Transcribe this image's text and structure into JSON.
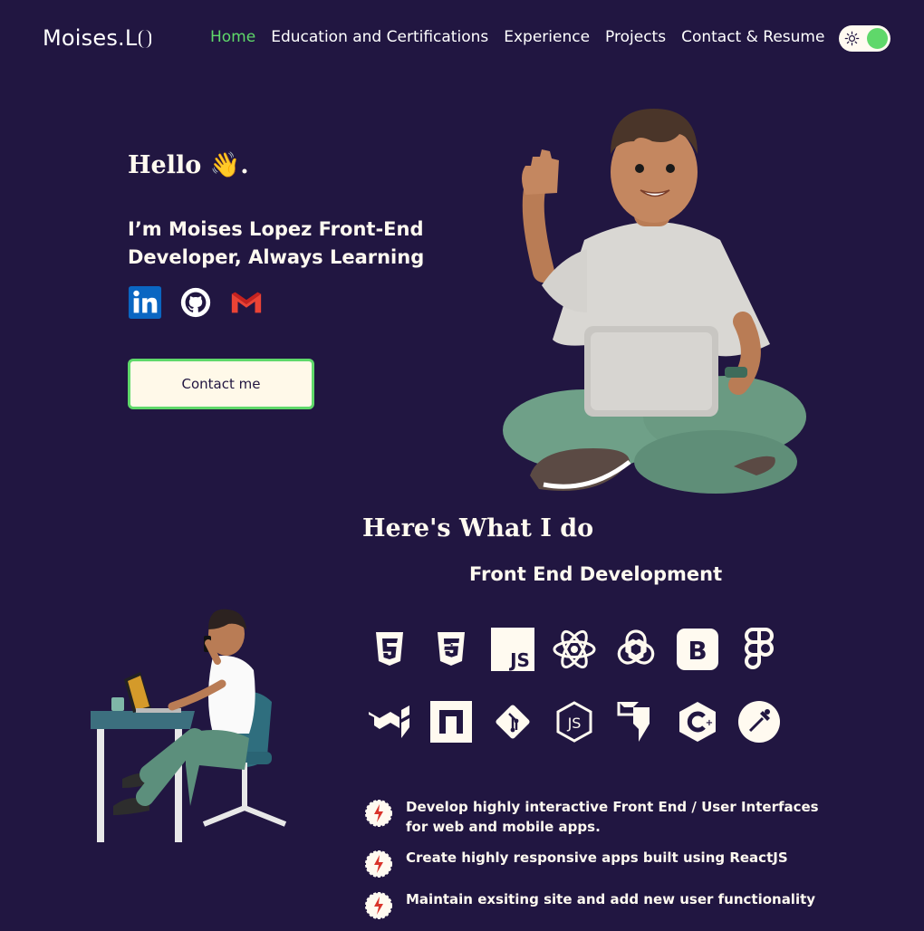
{
  "nav": {
    "logo": "Moises.L",
    "items": [
      {
        "label": "Home",
        "active": true
      },
      {
        "label": "Education and Certifications",
        "active": false
      },
      {
        "label": "Experience",
        "active": false
      },
      {
        "label": "Projects",
        "active": false
      },
      {
        "label": "Contact & Resume",
        "active": false
      }
    ],
    "theme_toggle": {
      "icon": "sun-icon",
      "state": "on"
    }
  },
  "hero": {
    "greeting": "Hello 👋.",
    "tagline": "I’m Moises Lopez Front-End Developer, Always Learning",
    "socials": [
      {
        "name": "linkedin-icon"
      },
      {
        "name": "github-icon"
      },
      {
        "name": "gmail-icon"
      }
    ],
    "contact_button": "Contact me"
  },
  "services": {
    "title": "Here's What I do",
    "subtitle": "Front End Development",
    "tech_icons": [
      "html5-icon",
      "css3-icon",
      "javascript-icon",
      "react-icon",
      "openai-icon",
      "bootstrap-icon",
      "figma-icon",
      "mui-icon",
      "nextjs-icon",
      "git-icon",
      "nodejs-icon",
      "framer-icon",
      "csharp-icon",
      "postman-icon"
    ],
    "bullets": [
      "Develop highly interactive Front End / User Interfaces for web and mobile apps.",
      "Create highly responsive apps built using ReactJS",
      "Maintain exsiting site and add new user functionality"
    ]
  },
  "colors": {
    "background": "#211641",
    "accent": "#5fd86a",
    "cream": "#fffaf0"
  }
}
